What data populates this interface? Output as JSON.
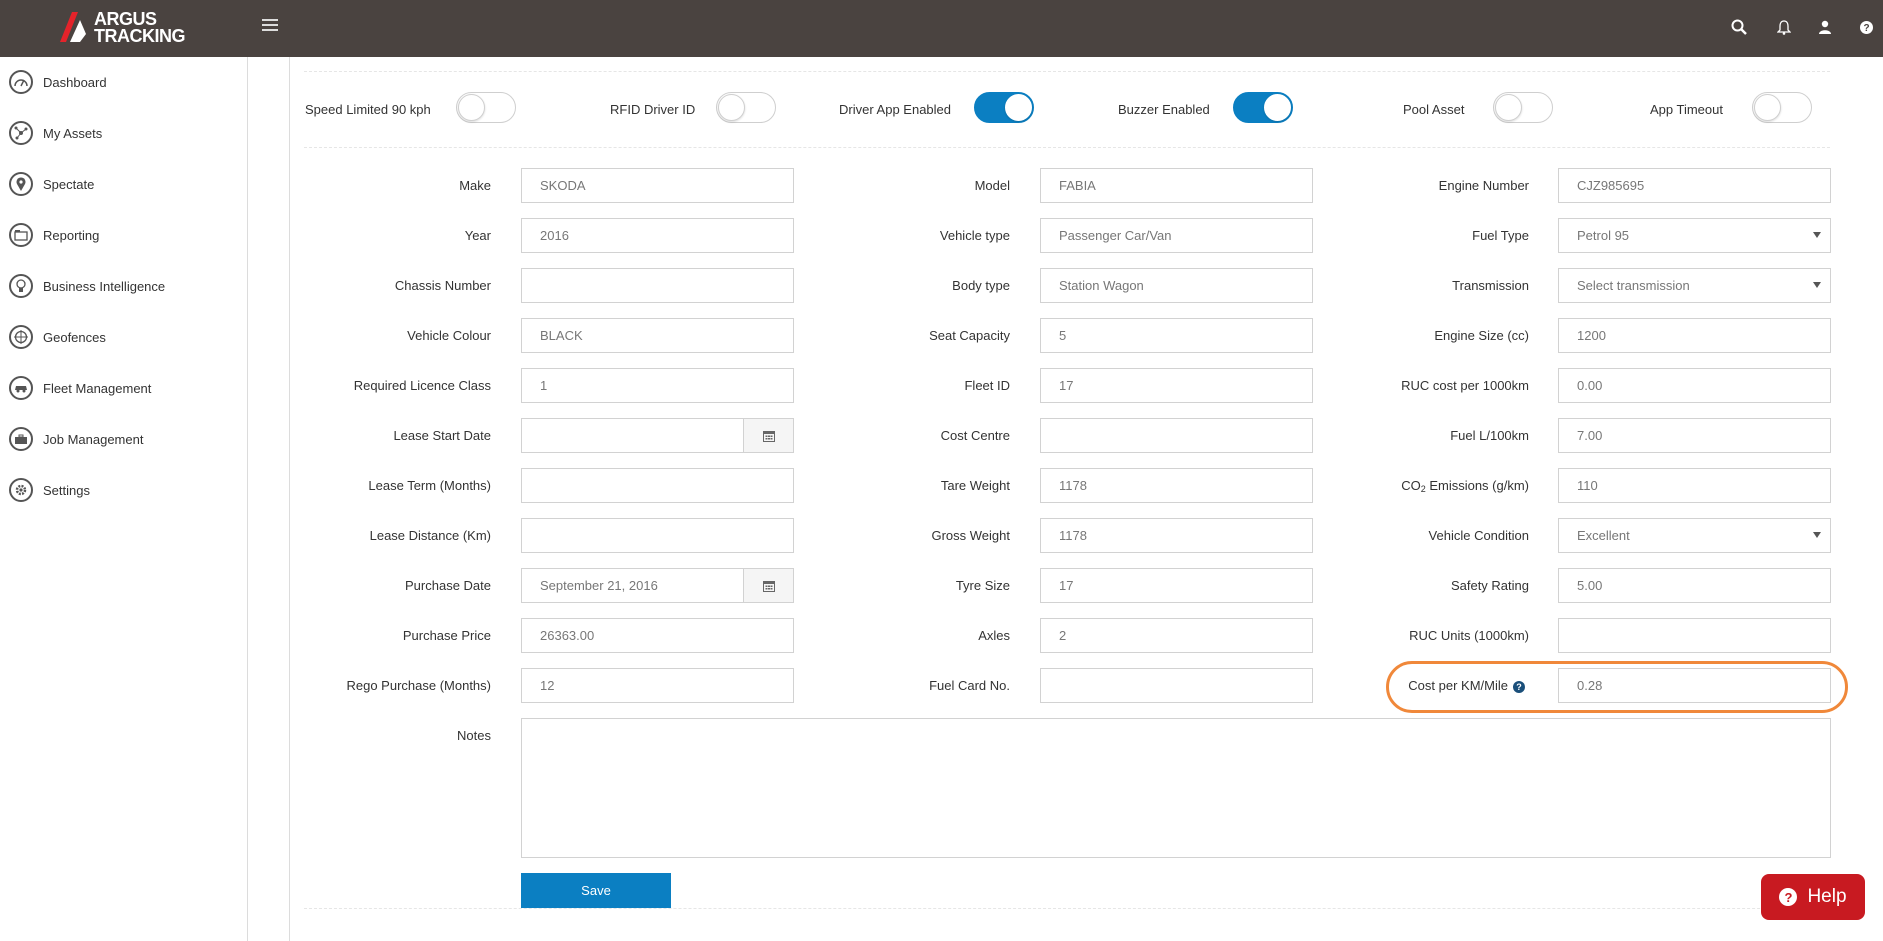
{
  "app": {
    "logo_line1": "ARGUS",
    "logo_line2": "TRACKING",
    "top_icons": [
      "search-icon",
      "bell-icon",
      "user-icon",
      "help-icon"
    ]
  },
  "sidebar": {
    "items": [
      {
        "label": "Dashboard",
        "icon": "gauge-icon"
      },
      {
        "label": "My Assets",
        "icon": "nodes-icon"
      },
      {
        "label": "Spectate",
        "icon": "map-pin-icon"
      },
      {
        "label": "Reporting",
        "icon": "report-icon"
      },
      {
        "label": "Business Intelligence",
        "icon": "lightbulb-icon"
      },
      {
        "label": "Geofences",
        "icon": "compass-icon"
      },
      {
        "label": "Fleet Management",
        "icon": "car-icon"
      },
      {
        "label": "Job Management",
        "icon": "briefcase-icon"
      },
      {
        "label": "Settings",
        "icon": "gear-icon"
      }
    ]
  },
  "toggles": [
    {
      "label": "Speed Limited 90 kph",
      "on": false
    },
    {
      "label": "RFID Driver ID",
      "on": false
    },
    {
      "label": "Driver App Enabled",
      "on": true
    },
    {
      "label": "Buzzer Enabled",
      "on": true
    },
    {
      "label": "Pool Asset",
      "on": false
    },
    {
      "label": "App Timeout",
      "on": false
    }
  ],
  "form": {
    "col1": [
      {
        "label": "Make",
        "value": "SKODA"
      },
      {
        "label": "Year",
        "value": "2016"
      },
      {
        "label": "Chassis Number",
        "value": ""
      },
      {
        "label": "Vehicle Colour",
        "value": "BLACK"
      },
      {
        "label": "Required Licence Class",
        "value": "1"
      },
      {
        "label": "Lease Start Date",
        "value": ""
      },
      {
        "label": "Lease Term (Months)",
        "value": ""
      },
      {
        "label": "Lease Distance (Km)",
        "value": ""
      },
      {
        "label": "Purchase Date",
        "value": "September 21, 2016"
      },
      {
        "label": "Purchase Price",
        "value": "26363.00"
      },
      {
        "label": "Rego Purchase (Months)",
        "value": "12"
      }
    ],
    "col2": [
      {
        "label": "Model",
        "value": "FABIA"
      },
      {
        "label": "Vehicle type",
        "value": "Passenger Car/Van"
      },
      {
        "label": "Body type",
        "value": "Station Wagon"
      },
      {
        "label": "Seat Capacity",
        "value": "5"
      },
      {
        "label": "Fleet ID",
        "value": "17"
      },
      {
        "label": "Cost Centre",
        "value": ""
      },
      {
        "label": "Tare Weight",
        "value": "1178"
      },
      {
        "label": "Gross Weight",
        "value": "1178"
      },
      {
        "label": "Tyre Size",
        "value": "17"
      },
      {
        "label": "Axles",
        "value": "2"
      },
      {
        "label": "Fuel Card No.",
        "value": ""
      }
    ],
    "col3": [
      {
        "label": "Engine Number",
        "value": "CJZ985695"
      },
      {
        "label": "Fuel Type",
        "value": "Petrol 95"
      },
      {
        "label": "Transmission",
        "value": "Select transmission"
      },
      {
        "label": "Engine Size (cc)",
        "value": "1200"
      },
      {
        "label": "RUC cost per 1000km",
        "value": "0.00"
      },
      {
        "label": "Fuel L/100km",
        "value": "7.00"
      },
      {
        "label_main": "CO",
        "label_sub": "2",
        "label_rest": " Emissions (g/km)",
        "value": "110"
      },
      {
        "label": "Vehicle Condition",
        "value": "Excellent"
      },
      {
        "label": "Safety Rating",
        "value": "5.00"
      },
      {
        "label": "RUC Units (1000km)",
        "value": ""
      },
      {
        "label": "Cost per KM/Mile",
        "value": "0.28"
      }
    ],
    "notes_label": "Notes",
    "save_label": "Save"
  },
  "help_button": {
    "label": "Help"
  },
  "colors": {
    "topbar": "#4a4340",
    "accent": "#0b7fc2",
    "highlight": "#f0883a",
    "help": "#c81a21"
  }
}
